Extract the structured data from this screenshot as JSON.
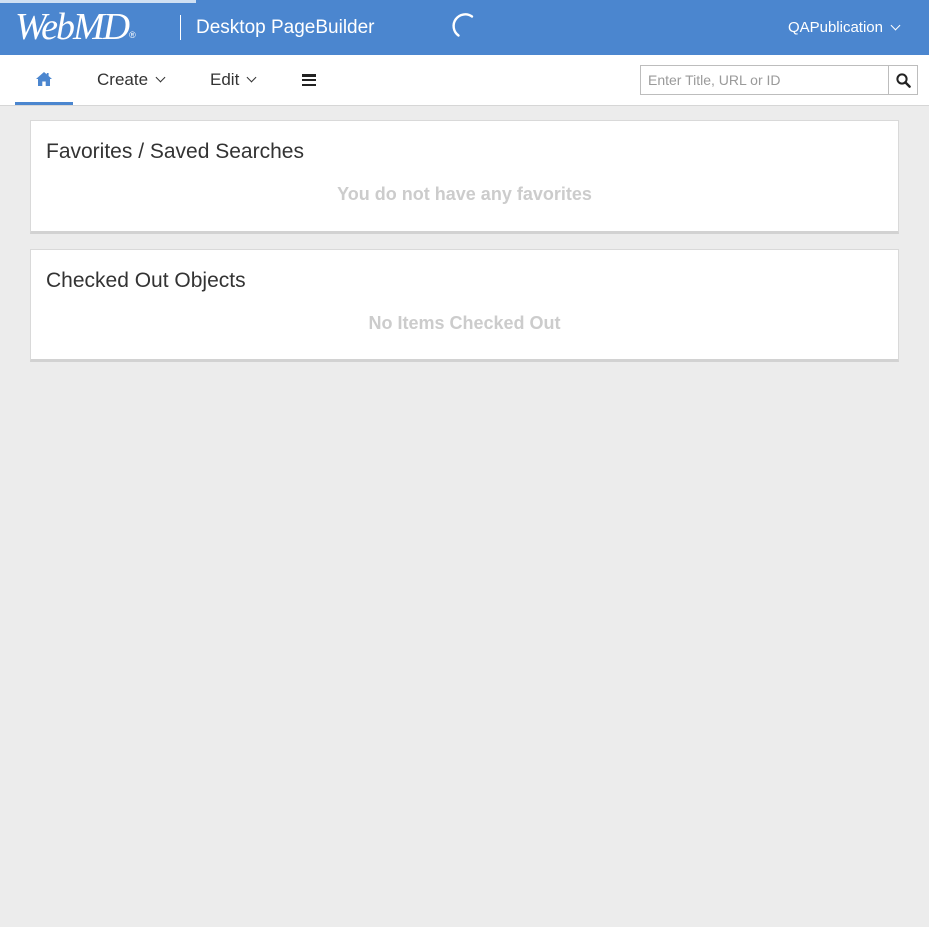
{
  "header": {
    "logo_text": "WebMD",
    "logo_mark": "®",
    "app_title": "Desktop PageBuilder",
    "loading_icon": "spinner-icon",
    "publication": "QAPublication",
    "publication_icon": "chevron-down-icon",
    "brand_color": "#4b86cf"
  },
  "nav": {
    "home_icon": "home-icon",
    "create_label": "Create",
    "edit_label": "Edit",
    "menu_icon": "hamburger-menu-icon",
    "search": {
      "placeholder": "Enter Title, URL or ID",
      "value": "",
      "icon": "search-icon"
    },
    "active_color": "#4b86cf"
  },
  "panels": {
    "favorites": {
      "title": "Favorites / Saved Searches",
      "empty_message": "You do not have any favorites"
    },
    "checked_out": {
      "title": "Checked Out Objects",
      "empty_message": "No Items Checked Out"
    }
  }
}
